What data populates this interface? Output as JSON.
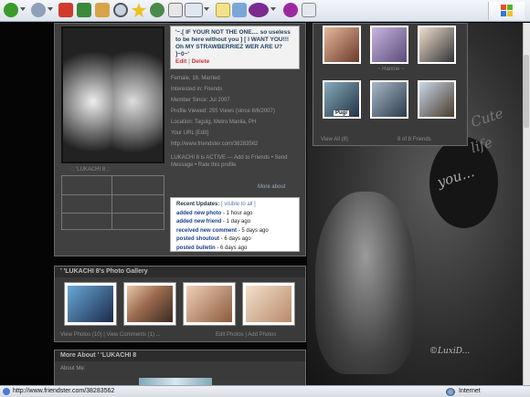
{
  "browser": {
    "status_url": "http://www.friendster.com/38283562",
    "zone_label": "Internet",
    "toolbar_icons": [
      "back-icon",
      "forward-icon",
      "stop-icon",
      "refresh-icon",
      "home-icon",
      "search-icon",
      "favorites-icon",
      "history-icon",
      "mail-icon",
      "print-icon",
      "edit-icon",
      "discuss-icon",
      "yahoo-icon",
      "messenger-icon"
    ]
  },
  "profile": {
    "photo_caption": ":: 'LUKACHI 8 ::",
    "headline": "'~.[ IF YOUR NOT THE ONE.... so useless to be here without you ] [ I WANT YOU!!! Oh MY STRAWBERRIEZ WER ARE U? ]~0~'",
    "edit_label": "Edit",
    "separator": "|",
    "delete_label": "Delete",
    "details": [
      "Female, 16, Married",
      "Interested in: Friends",
      "Member Since: Jul 2007",
      "Profile Viewed: 255 Views (since 8/6/2007)",
      "Location: Taguig, Metro Manila, PH",
      "Your URL [Edit]",
      "http://www.friendster.com/38283562"
    ],
    "about_snip": "LUKACHI 8 is ACTIVE — Add to Friends • Send Message • Rate this profile",
    "more_about": "More about",
    "updates_title": "Recent Updates:",
    "updates_visible": "[ visible to all ]",
    "updates": [
      {
        "link": "added new photo",
        "time": " - 1 hour ago"
      },
      {
        "link": "added new friend",
        "time": " - 1 day ago"
      },
      {
        "link": "received new comment",
        "time": " - 5 days ago"
      },
      {
        "link": "posted shoutout",
        "time": " - 6 days ago"
      },
      {
        "link": "posted bulletin",
        "time": " - 6 days ago"
      }
    ]
  },
  "gallery": {
    "title": "' 'LUKACHI 8's Photo Gallery",
    "footer_left": "View Photos (10) | View Comments (1) ...",
    "footer_right": "Edit Photos | Add Photos"
  },
  "friends": {
    "names": [
      "",
      "~ Hannie ~",
      "",
      "Pugi",
      "",
      ""
    ],
    "footer_left": "View All (8)",
    "footer_right": "8 of 8 Friends"
  },
  "more_about": {
    "title": "More About ' 'LUKACHI 8",
    "about_me": "About Me:"
  },
  "deco": {
    "line1": "Cute",
    "line2": "life",
    "line3": "you...",
    "signature": "©LuxiD..."
  }
}
